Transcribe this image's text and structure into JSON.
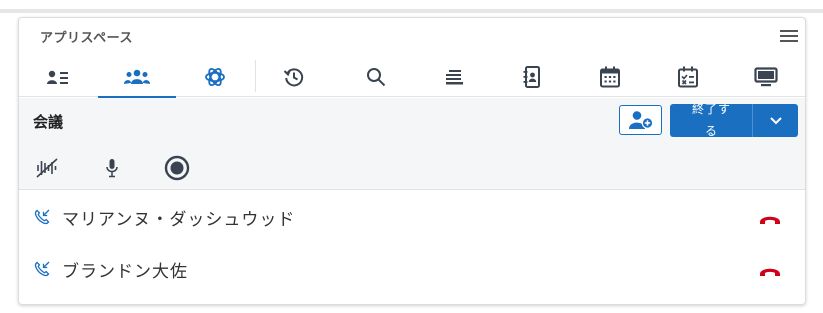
{
  "panel": {
    "title": "アプリスペース",
    "menu_icon": "hamburger-menu-icon"
  },
  "tabs": [
    {
      "icon": "contact-card-icon",
      "active": false
    },
    {
      "icon": "people-group-icon",
      "active": true
    },
    {
      "icon": "ai-flower-icon",
      "active": false
    },
    {
      "icon": "history-icon",
      "active": false
    },
    {
      "icon": "search-icon",
      "active": false
    },
    {
      "icon": "queue-list-icon",
      "active": false
    },
    {
      "icon": "address-book-icon",
      "active": false
    },
    {
      "icon": "calendar-icon",
      "active": false
    },
    {
      "icon": "task-checklist-icon",
      "active": false
    },
    {
      "icon": "monitor-icon",
      "active": false
    }
  ],
  "meeting": {
    "title": "会議",
    "add_participant_icon": "add-person-icon",
    "end_button_label": "終了する",
    "end_dropdown_icon": "chevron-down-icon",
    "controls": [
      "audio-wave-muted-icon",
      "microphone-icon",
      "record-icon"
    ]
  },
  "participants": [
    {
      "name": "マリアンヌ・ダッシュウッド",
      "status_icon": "phone-incoming-icon",
      "hangup_icon": "hang-up-icon"
    },
    {
      "name": "ブランドン大佐",
      "status_icon": "phone-incoming-icon",
      "hangup_icon": "hang-up-icon"
    }
  ],
  "colors": {
    "accent": "#1a6fc1",
    "hangup": "#d0021b",
    "icon": "#3a4450"
  }
}
